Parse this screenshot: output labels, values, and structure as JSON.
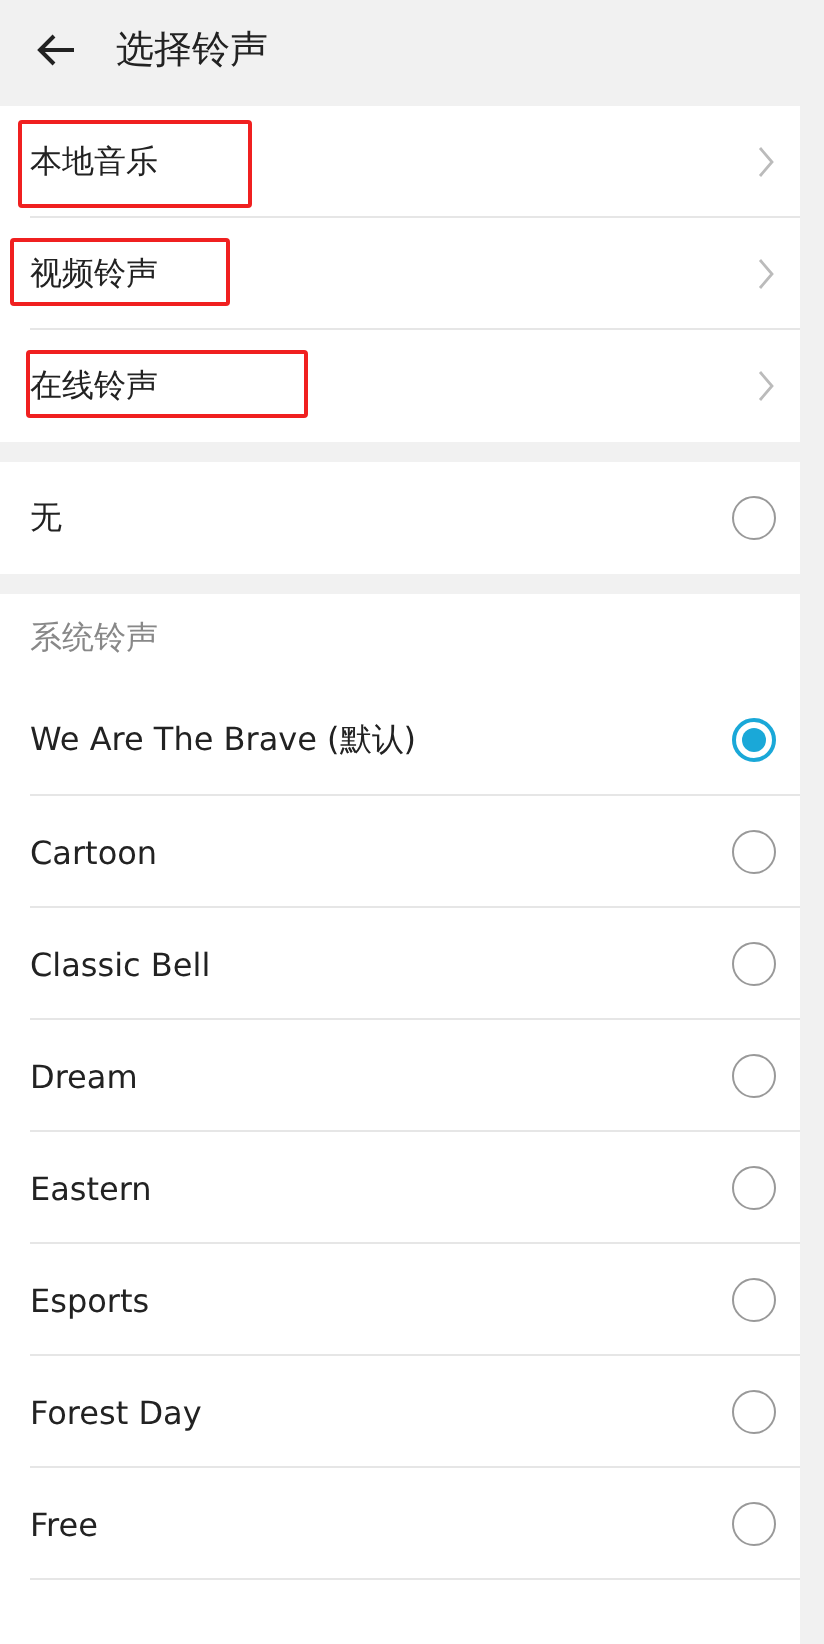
{
  "header": {
    "title": "选择铃声"
  },
  "sources": [
    {
      "label": "本地音乐",
      "highlighted": true
    },
    {
      "label": "视频铃声",
      "highlighted": true
    },
    {
      "label": "在线铃声",
      "highlighted": true
    }
  ],
  "none_option": {
    "label": "无",
    "selected": false
  },
  "system": {
    "title": "系统铃声",
    "items": [
      {
        "label": "We Are The Brave (默认)",
        "selected": true
      },
      {
        "label": "Cartoon",
        "selected": false
      },
      {
        "label": "Classic Bell",
        "selected": false
      },
      {
        "label": "Dream",
        "selected": false
      },
      {
        "label": "Eastern",
        "selected": false
      },
      {
        "label": "Esports",
        "selected": false
      },
      {
        "label": "Forest Day",
        "selected": false
      },
      {
        "label": "Free",
        "selected": false
      }
    ]
  }
}
